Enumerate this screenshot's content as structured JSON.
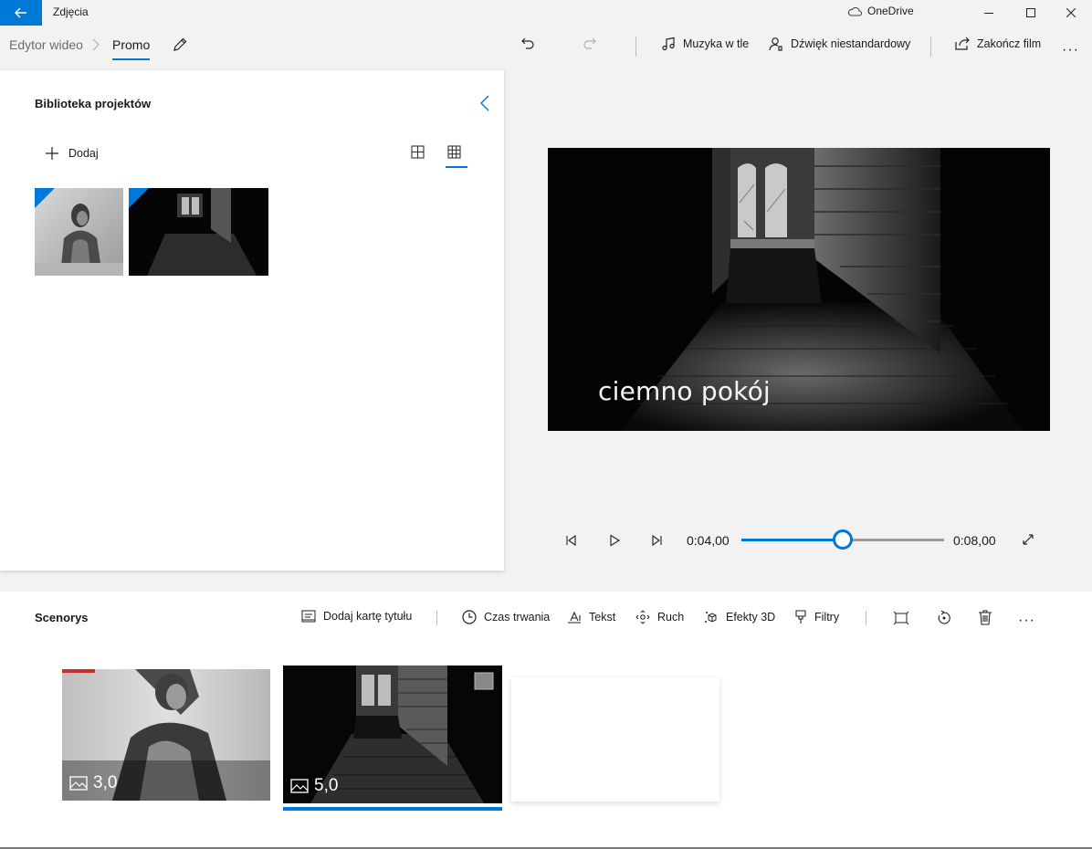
{
  "titlebar": {
    "app_title": "Zdjęcia",
    "onedrive_label": "OneDrive",
    "accent_color": "#0078d7"
  },
  "breadcrumb": {
    "root": "Edytor wideo",
    "current": "Promo"
  },
  "toolbar": {
    "music_label": "Muzyka w tle",
    "custom_audio_label": "Dźwięk niestandardowy",
    "finish_label": "Zakończ film"
  },
  "library": {
    "title": "Biblioteka projektów",
    "add_label": "Dodaj"
  },
  "preview": {
    "caption": "ciemno pokój"
  },
  "playback": {
    "current_time": "0:04,00",
    "total_time": "0:08,00",
    "progress": 0.5
  },
  "storyboard": {
    "title": "Scenorys",
    "add_title_card": "Dodaj kartę tytułu",
    "duration_label": "Czas trwania",
    "text_label": "Tekst",
    "motion_label": "Ruch",
    "effects_label": "Efekty 3D",
    "filters_label": "Filtry",
    "cards": [
      {
        "duration": "3,0"
      },
      {
        "duration": "5,0"
      }
    ]
  }
}
